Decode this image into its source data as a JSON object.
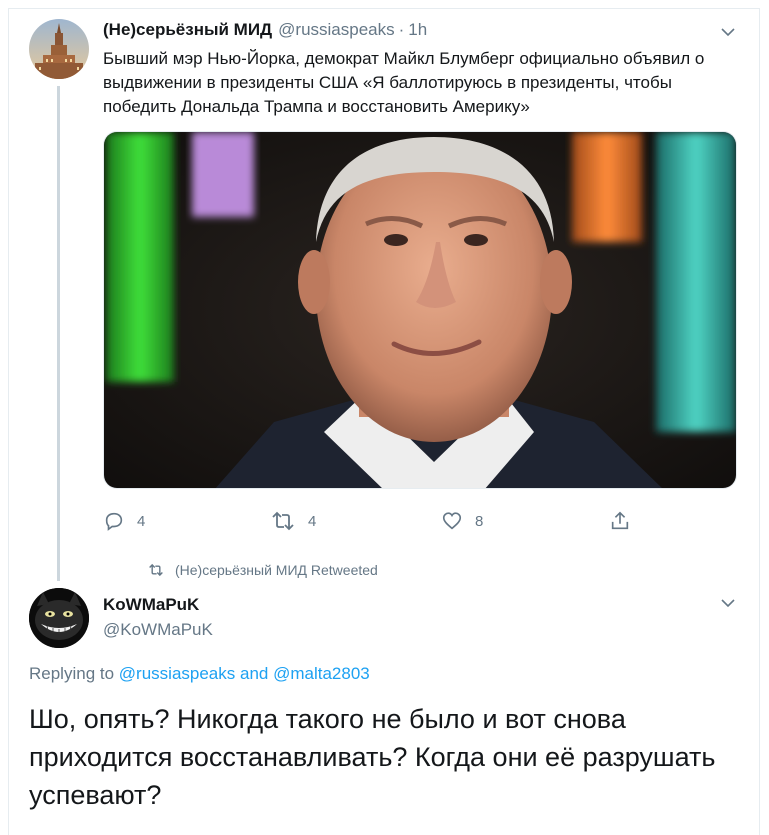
{
  "tweet": {
    "author_name": "(Не)серьёзный МИД",
    "author_handle": "@russiaspeaks",
    "separator": "·",
    "time": "1h",
    "text": "Бывший мэр Нью-Йорка, демократ Майкл Блумберг официально объявил о выдвижении в президенты США «Я баллотируюсь в президенты, чтобы победить Дональда Трампа и восстановить Америку»",
    "image_alt": "photo-of-michael-bloomberg",
    "reply_count": "4",
    "retweet_count": "4",
    "like_count": "8"
  },
  "retweet_indicator": {
    "label": "(Не)серьёзный МИД Retweeted"
  },
  "reply": {
    "author_name": "KoWMaPuK",
    "author_handle": "@KoWMaPuK",
    "replying_prefix": "Replying to",
    "replying_user1": "@russiaspeaks",
    "replying_and": "and",
    "replying_user2": "@malta2803",
    "text": "Шо, опять? Никогда такого не было и вот снова приходится восстанавливать? Когда они её разрушать успевают?"
  },
  "colors": {
    "link": "#1da1f2",
    "secondary_text": "#657786",
    "thread_line": "#ccd6dd"
  }
}
